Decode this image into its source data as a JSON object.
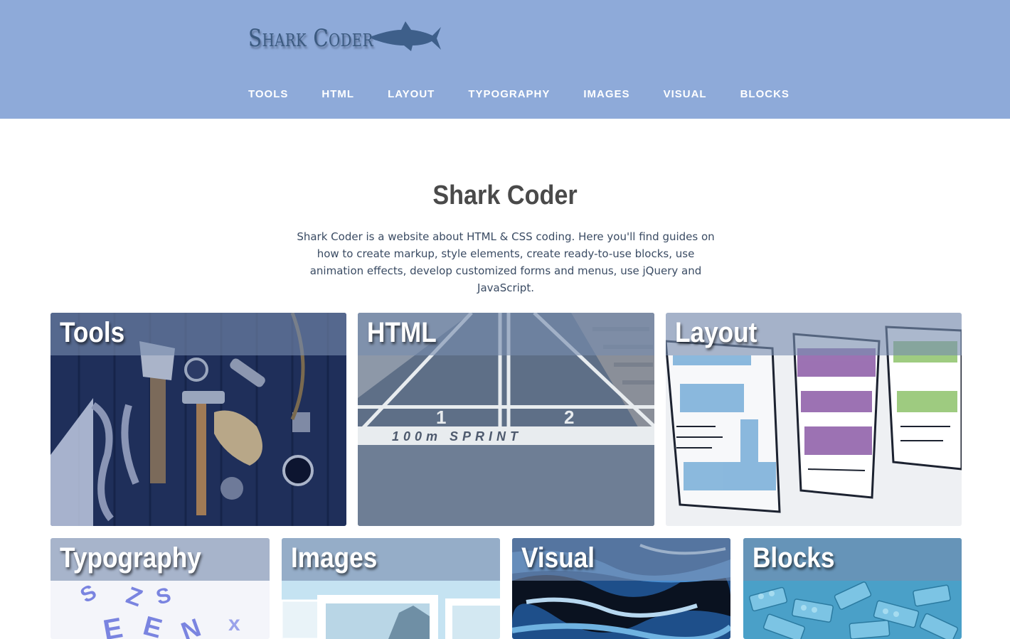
{
  "header": {
    "logo_text": "Shark Coder",
    "logo_icon": "shark-icon",
    "nav": [
      "TOOLS",
      "HTML",
      "LAYOUT",
      "TYPOGRAPHY",
      "IMAGES",
      "VISUAL",
      "BLOCKS"
    ]
  },
  "hero": {
    "title": "Shark Coder",
    "description": "Shark Coder is a website about HTML & CSS coding. Here you'll find guides on how to create markup, style elements, create ready-to-use blocks, use animation effects, develop customized forms and menus, use jQuery and JavaScript."
  },
  "cards": {
    "tools": "Tools",
    "html": "HTML",
    "layout": "Layout",
    "typography": "Typography",
    "images": "Images",
    "visual": "Visual",
    "blocks": "Blocks"
  },
  "track_text": {
    "lane1": "1",
    "lane2": "2",
    "sprint": "100m SPRINT"
  },
  "colors": {
    "header_bg": "#8eaad9",
    "logo": "#3b5a80",
    "title": "#4a4a4a",
    "description": "#3a4b63"
  }
}
